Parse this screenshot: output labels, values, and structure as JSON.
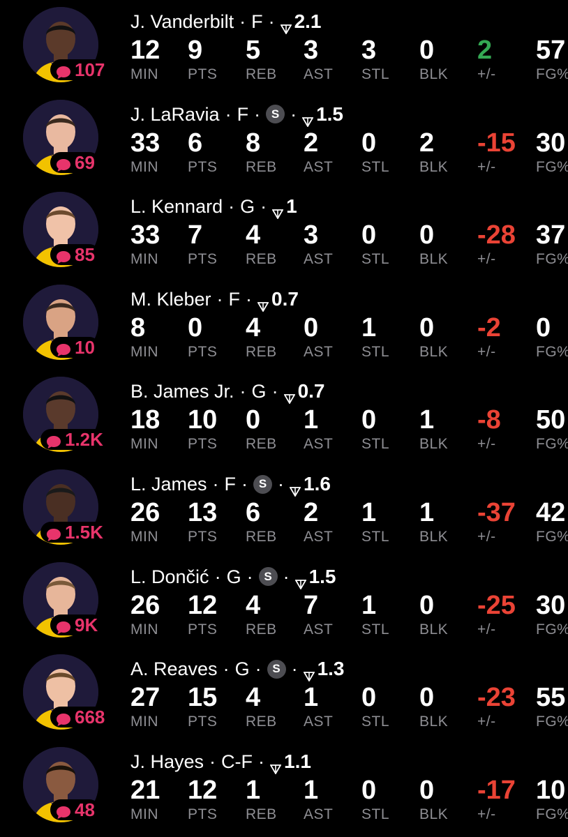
{
  "colors": {
    "background": "#000000",
    "comment": "#e8346b",
    "negative": "#ea4335",
    "positive": "#34a853",
    "label": "#8e8e93",
    "starter_badge": "#4d4d52"
  },
  "stat_labels": [
    "MIN",
    "PTS",
    "REB",
    "AST",
    "STL",
    "BLK",
    "+/-",
    "FG%"
  ],
  "players": [
    {
      "name": "J. Vanderbilt",
      "pos": "F",
      "starter": false,
      "rating": "2.1",
      "comments": "107",
      "stats": [
        "12",
        "9",
        "5",
        "3",
        "3",
        "0",
        "2",
        "57"
      ],
      "plus_minus_sign": "positive"
    },
    {
      "name": "J. LaRavia",
      "pos": "F",
      "starter": true,
      "rating": "1.5",
      "comments": "69",
      "stats": [
        "33",
        "6",
        "8",
        "2",
        "0",
        "2",
        "-15",
        "30"
      ],
      "plus_minus_sign": "negative"
    },
    {
      "name": "L. Kennard",
      "pos": "G",
      "starter": false,
      "rating": "1",
      "comments": "85",
      "stats": [
        "33",
        "7",
        "4",
        "3",
        "0",
        "0",
        "-28",
        "37"
      ],
      "plus_minus_sign": "negative"
    },
    {
      "name": "M. Kleber",
      "pos": "F",
      "starter": false,
      "rating": "0.7",
      "comments": "10",
      "stats": [
        "8",
        "0",
        "4",
        "0",
        "1",
        "0",
        "-2",
        "0"
      ],
      "plus_minus_sign": "negative"
    },
    {
      "name": "B. James Jr.",
      "pos": "G",
      "starter": false,
      "rating": "0.7",
      "comments": "1.2K",
      "stats": [
        "18",
        "10",
        "0",
        "1",
        "0",
        "1",
        "-8",
        "50"
      ],
      "plus_minus_sign": "negative"
    },
    {
      "name": "L. James",
      "pos": "F",
      "starter": true,
      "rating": "1.6",
      "comments": "1.5K",
      "stats": [
        "26",
        "13",
        "6",
        "2",
        "1",
        "1",
        "-37",
        "42"
      ],
      "plus_minus_sign": "negative"
    },
    {
      "name": "L. Dončić",
      "pos": "G",
      "starter": true,
      "rating": "1.5",
      "comments": "9K",
      "stats": [
        "26",
        "12",
        "4",
        "7",
        "1",
        "0",
        "-25",
        "30"
      ],
      "plus_minus_sign": "negative"
    },
    {
      "name": "A. Reaves",
      "pos": "G",
      "starter": true,
      "rating": "1.3",
      "comments": "668",
      "stats": [
        "27",
        "15",
        "4",
        "1",
        "0",
        "0",
        "-23",
        "55"
      ],
      "plus_minus_sign": "negative"
    },
    {
      "name": "J. Hayes",
      "pos": "C-F",
      "starter": false,
      "rating": "1.1",
      "comments": "48",
      "stats": [
        "21",
        "12",
        "1",
        "1",
        "0",
        "0",
        "-17",
        "10"
      ],
      "plus_minus_sign": "negative"
    }
  ],
  "starter_badge_letter": "S",
  "separator": "·"
}
